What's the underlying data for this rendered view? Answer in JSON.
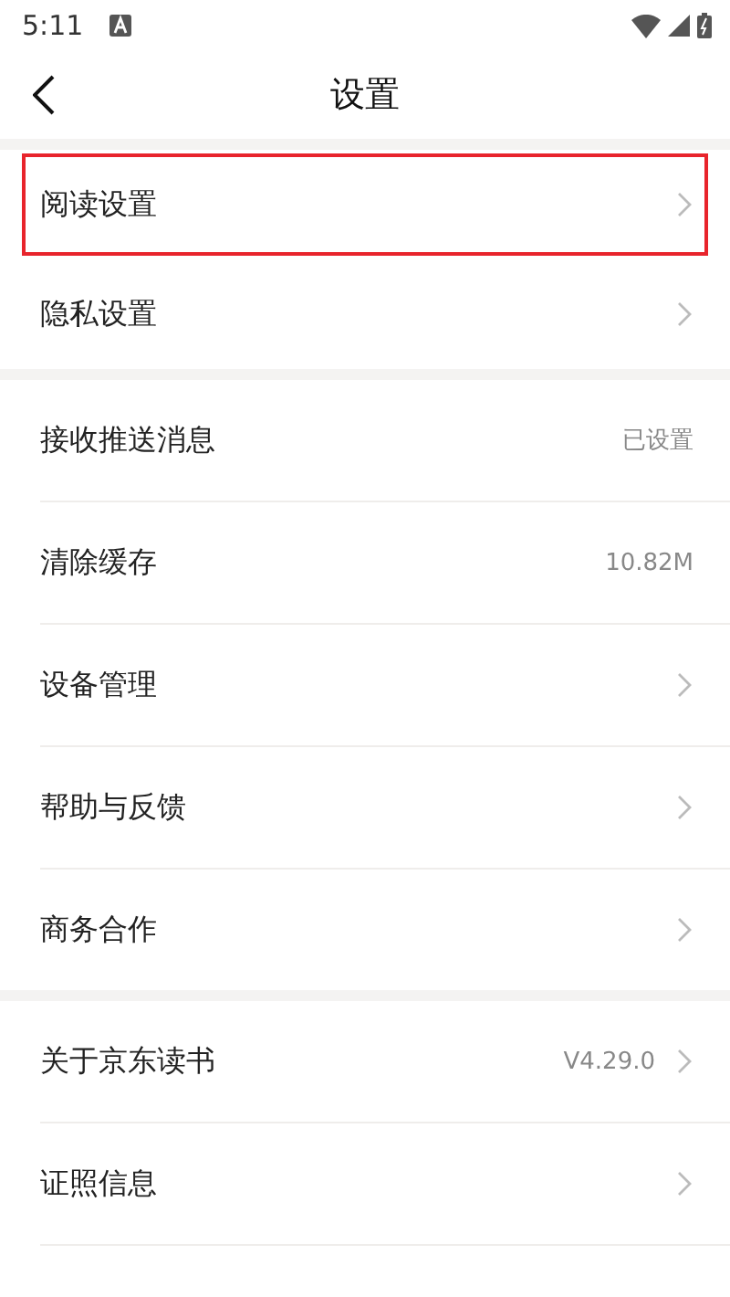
{
  "status_bar": {
    "time": "5:11"
  },
  "header": {
    "title": "设置"
  },
  "groups": [
    {
      "items": [
        {
          "label": "阅读设置",
          "chevron": true,
          "highlighted": true
        },
        {
          "label": "隐私设置",
          "chevron": true,
          "highlighted": false
        }
      ]
    },
    {
      "items": [
        {
          "label": "接收推送消息",
          "value": "已设置",
          "chevron": false,
          "highlighted": false
        },
        {
          "label": "清除缓存",
          "value": "10.82M",
          "chevron": false,
          "highlighted": false
        },
        {
          "label": "设备管理",
          "chevron": true,
          "highlighted": false
        },
        {
          "label": "帮助与反馈",
          "chevron": true,
          "highlighted": false
        },
        {
          "label": "商务合作",
          "chevron": true,
          "highlighted": false
        }
      ]
    },
    {
      "items": [
        {
          "label": "关于京东读书",
          "value": "V4.29.0",
          "chevron": true,
          "highlighted": false
        },
        {
          "label": "证照信息",
          "chevron": true,
          "highlighted": false
        }
      ]
    }
  ]
}
